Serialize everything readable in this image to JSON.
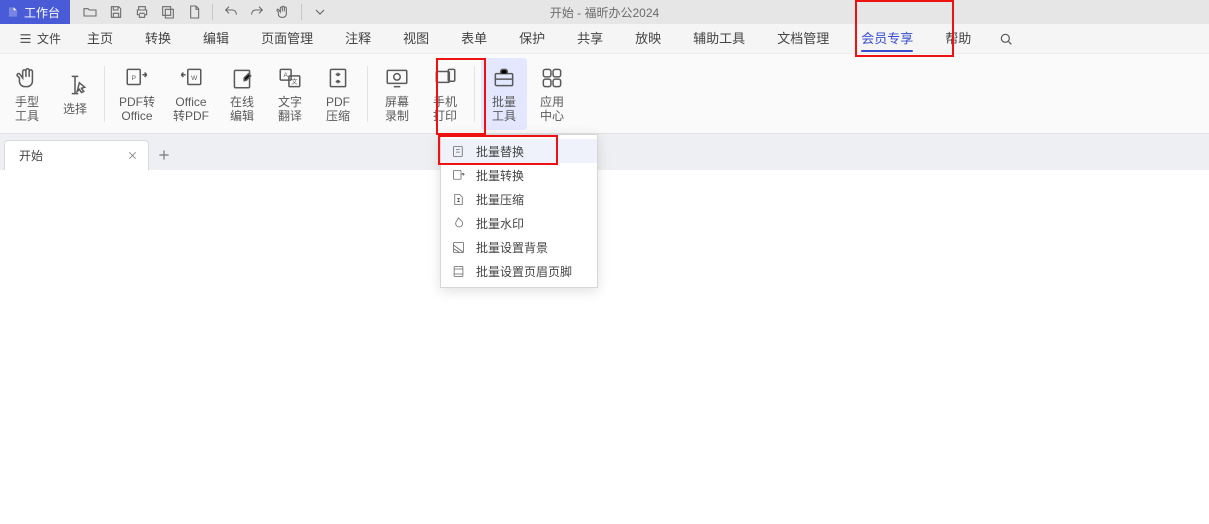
{
  "title": "开始 - 福昕办公2024",
  "workspace_label": "工作台",
  "menubar": {
    "file": "文件",
    "items": [
      "主页",
      "转换",
      "编辑",
      "页面管理",
      "注释",
      "视图",
      "表单",
      "保护",
      "共享",
      "放映",
      "辅助工具",
      "文档管理",
      "会员专享",
      "帮助"
    ],
    "active_index": 12
  },
  "ribbon": {
    "items": [
      {
        "label": "手型\n工具"
      },
      {
        "label": "选择"
      },
      {
        "label": "PDF转\nOffice"
      },
      {
        "label": "Office\n转PDF"
      },
      {
        "label": "在线\n编辑"
      },
      {
        "label": "文字\n翻译"
      },
      {
        "label": "PDF\n压缩"
      },
      {
        "label": "屏幕\n录制"
      },
      {
        "label": "手机\n打印"
      },
      {
        "label": "批量\n工具"
      },
      {
        "label": "应用\n中心"
      }
    ],
    "separators_after": [
      1,
      6,
      8
    ],
    "active_index": 9
  },
  "tab": {
    "label": "开始"
  },
  "dropdown": {
    "items": [
      "批量替换",
      "批量转换",
      "批量压缩",
      "批量水印",
      "批量设置背景",
      "批量设置页眉页脚"
    ],
    "hover_index": 0
  }
}
